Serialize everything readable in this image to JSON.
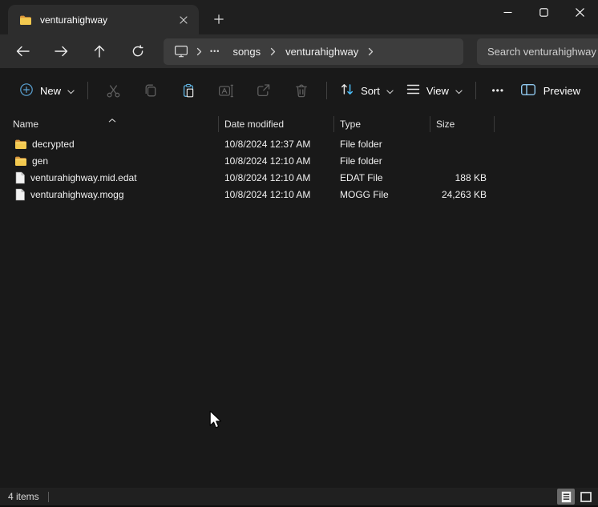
{
  "window": {
    "tab_title": "venturahighway"
  },
  "breadcrumb": {
    "overflow_dots": "•••",
    "items": [
      "songs",
      "venturahighway"
    ]
  },
  "search": {
    "placeholder": "Search venturahighway"
  },
  "toolbar": {
    "new_label": "New",
    "sort_label": "Sort",
    "view_label": "View",
    "more_dots": "•••",
    "preview_label": "Preview"
  },
  "list": {
    "columns": [
      "Name",
      "Date modified",
      "Type",
      "Size"
    ],
    "files": [
      {
        "icon": "folder",
        "name": "decrypted",
        "date": "10/8/2024 12:37 AM",
        "type": "File folder",
        "size": ""
      },
      {
        "icon": "folder",
        "name": "gen",
        "date": "10/8/2024 12:10 AM",
        "type": "File folder",
        "size": ""
      },
      {
        "icon": "file",
        "name": "venturahighway.mid.edat",
        "date": "10/8/2024 12:10 AM",
        "type": "EDAT File",
        "size": "188 KB"
      },
      {
        "icon": "file",
        "name": "venturahighway.mogg",
        "date": "10/8/2024 12:10 AM",
        "type": "MOGG File",
        "size": "24,263 KB"
      }
    ]
  },
  "status_bar": {
    "item_count": "4 items"
  },
  "colors": {
    "accent_blue": "#4cc2ff",
    "paste_blue": "#5fb2e0",
    "folder_front": "#f3c94f",
    "folder_back": "#d9953a",
    "titlebar_bg": "#1f1f1f",
    "chrome_bg": "#2d2d2d",
    "pill_bg": "#3d3d3d",
    "content_bg": "#191919"
  }
}
